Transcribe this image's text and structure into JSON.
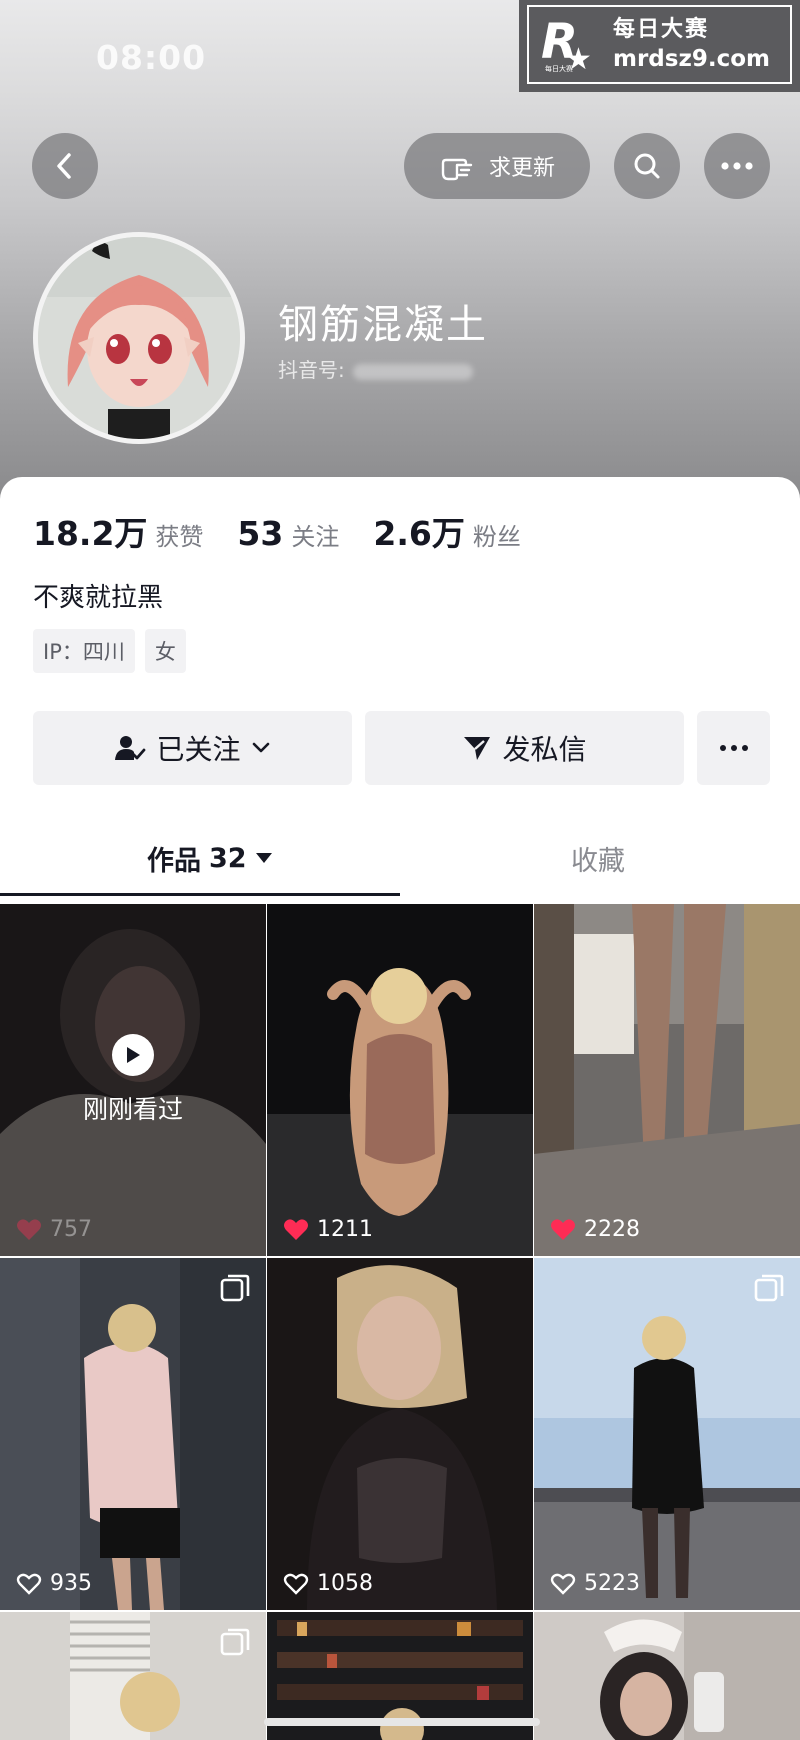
{
  "status_bar": {
    "time": "08:00"
  },
  "watermark": {
    "brand_cn": "每日大赛",
    "url": "mrdsz9.com",
    "logo_letter": "R",
    "logo_tiny": "每日大赛"
  },
  "header": {
    "request_update_label": "求更新",
    "nickname": "钢筋混凝土",
    "douyin_id_label": "抖音号:"
  },
  "stats": [
    {
      "value": "18.2万",
      "label": "获赞"
    },
    {
      "value": "53",
      "label": "关注"
    },
    {
      "value": "2.6万",
      "label": "粉丝"
    }
  ],
  "bio": "不爽就拉黑",
  "tags": [
    "IP：四川",
    "女"
  ],
  "actions": {
    "follow_label": "已关注",
    "message_label": "发私信"
  },
  "tabs": {
    "works_label": "作品",
    "works_count": "32",
    "favorites_label": "收藏"
  },
  "videos": [
    {
      "likes": "757",
      "liked": true,
      "watched_label": "刚刚看过"
    },
    {
      "likes": "1211",
      "liked": true
    },
    {
      "likes": "2228",
      "liked": true
    },
    {
      "likes": "935",
      "liked": false,
      "multi": true
    },
    {
      "likes": "1058",
      "liked": false
    },
    {
      "likes": "5223",
      "liked": false,
      "multi": true
    },
    {
      "multi": true
    },
    {},
    {}
  ],
  "colors": {
    "like_red": "#fe2c55",
    "text_dark": "#161823",
    "text_gray": "#7b7d85"
  }
}
